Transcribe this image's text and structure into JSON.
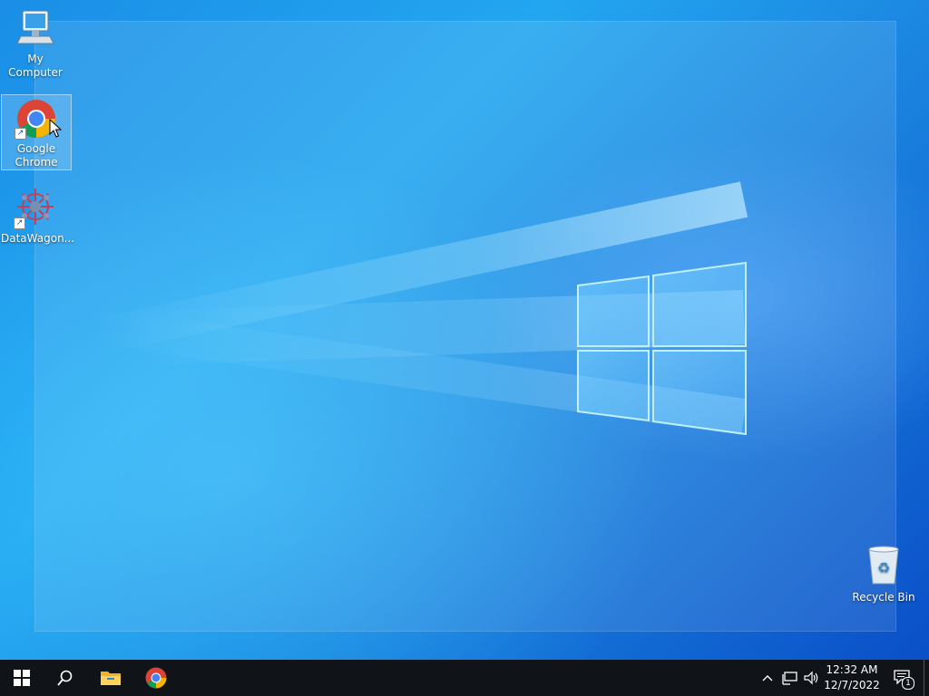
{
  "desktop": {
    "icons": [
      {
        "label": "My Computer",
        "icon": "computer-icon"
      },
      {
        "label": "Google Chrome",
        "label_line1": "Google",
        "label_line2": "Chrome",
        "icon": "chrome-icon",
        "selected": true
      },
      {
        "label": "DataWagon...",
        "icon": "datawagon-icon"
      },
      {
        "label": "Recycle Bin",
        "icon": "recycle-bin-icon"
      }
    ]
  },
  "taskbar": {
    "pinned": [
      {
        "name": "start",
        "icon": "windows-start-icon"
      },
      {
        "name": "search",
        "icon": "search-icon"
      },
      {
        "name": "file-explorer",
        "icon": "folder-icon"
      },
      {
        "name": "chrome",
        "icon": "chrome-icon"
      }
    ],
    "tray": {
      "icons": [
        "chevron-up-icon",
        "network-icon",
        "volume-icon"
      ],
      "time": "12:32 AM",
      "date": "12/7/2022",
      "notifications": "1"
    }
  },
  "colors": {
    "taskbar_bg": "#101418",
    "desktop_accent": "#1a8ee6"
  }
}
